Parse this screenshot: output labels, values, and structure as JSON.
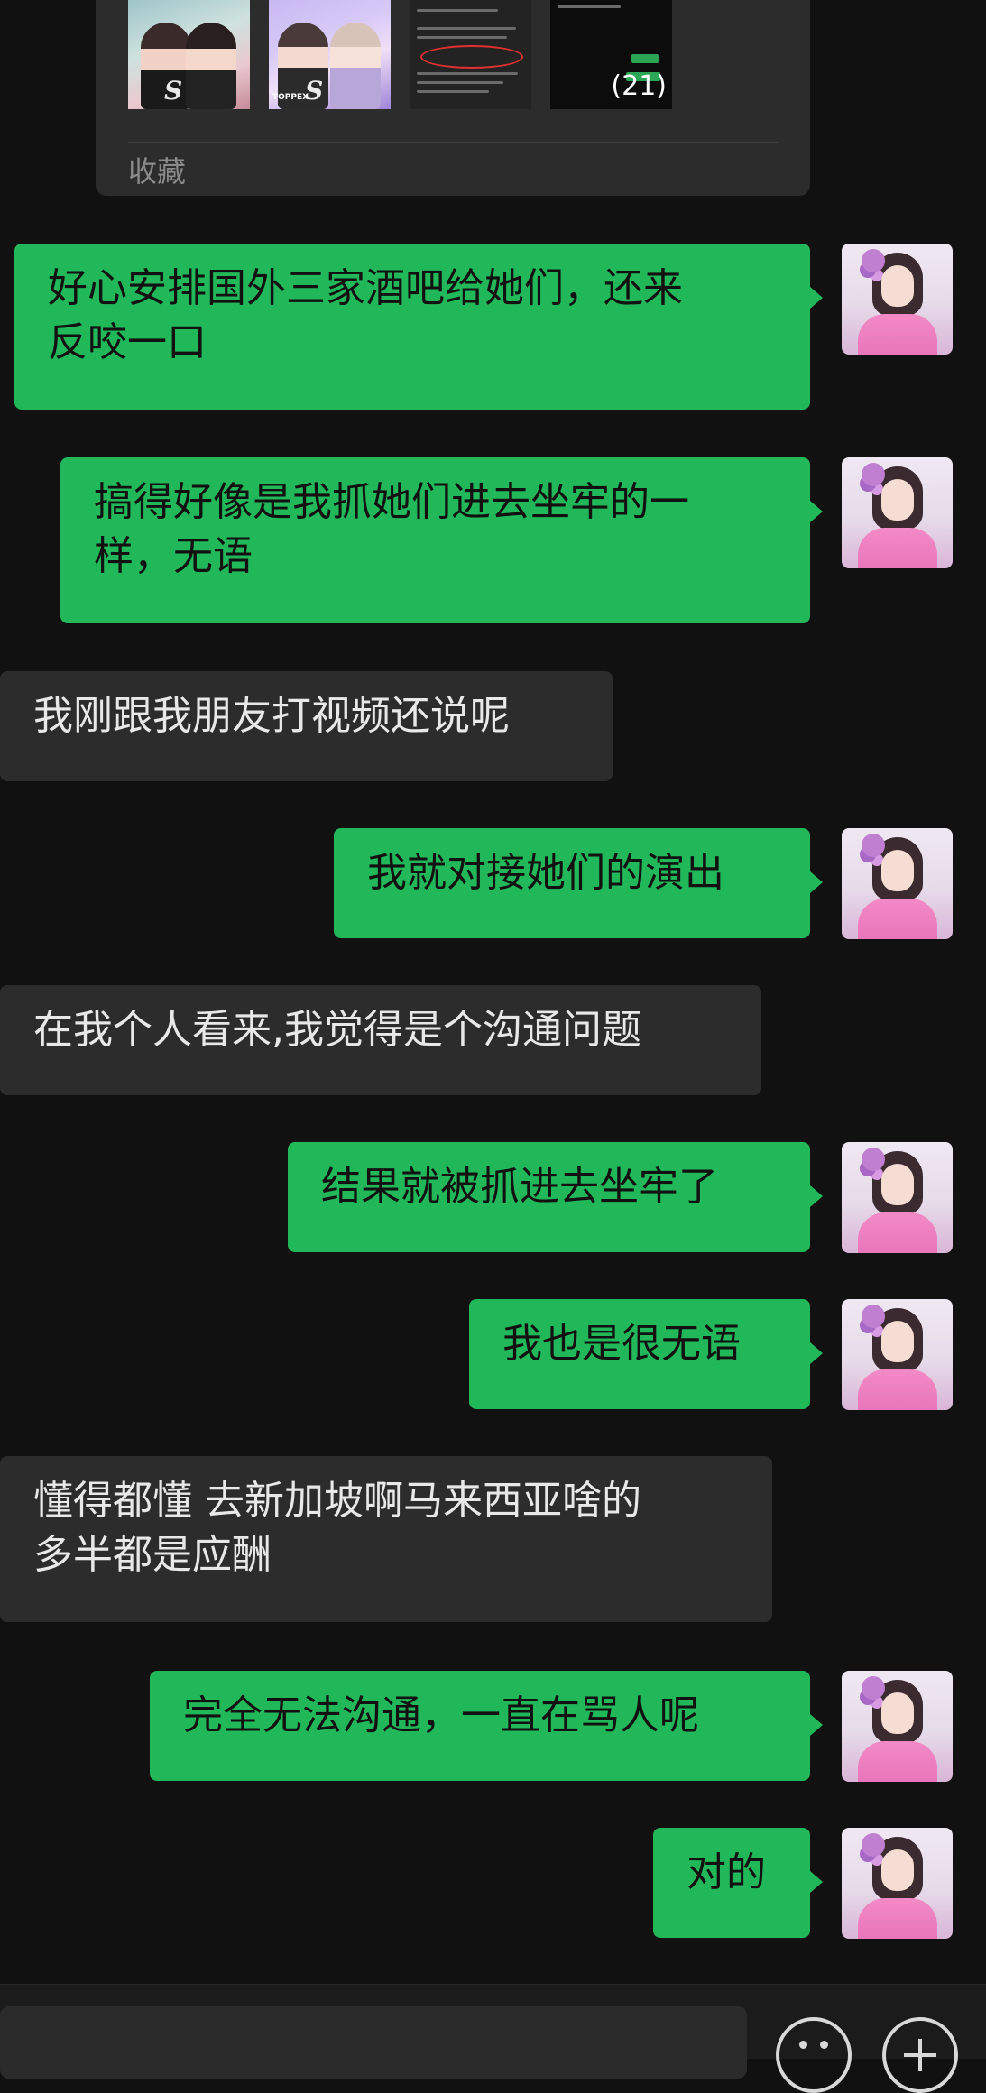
{
  "favorites_card": {
    "label": "收藏",
    "thumbnails": [
      {
        "kind": "poster",
        "caption": "S"
      },
      {
        "kind": "poster",
        "caption": "S",
        "brand": "TOPPEX"
      },
      {
        "kind": "chat-screenshot"
      },
      {
        "kind": "chat-screenshot",
        "count": "(21)"
      }
    ]
  },
  "messages": [
    {
      "side": "out",
      "text": "好心安排国外三家酒吧给她们，还来反咬一口",
      "lines": [
        "好心安排国外三家酒吧给她们，还来",
        "反咬一口"
      ]
    },
    {
      "side": "out",
      "text": "搞得好像是我抓她们进去坐牢的一样，无语",
      "lines": [
        "搞得好像是我抓她们进去坐牢的一",
        "样，无语"
      ]
    },
    {
      "side": "in",
      "text": "我刚跟我朋友打视频还说呢"
    },
    {
      "side": "out",
      "text": "我就对接她们的演出"
    },
    {
      "side": "in",
      "text": "在我个人看来,我觉得是个沟通问题"
    },
    {
      "side": "out",
      "text": "结果就被抓进去坐牢了"
    },
    {
      "side": "out",
      "text": "我也是很无语"
    },
    {
      "side": "in",
      "text": "懂得都懂 去新加坡啊马来西亚啥的多半都是应酬",
      "lines": [
        "懂得都懂 去新加坡啊马来西亚啥的",
        "多半都是应酬"
      ]
    },
    {
      "side": "out",
      "text": "完全无法沟通，一直在骂人呢"
    },
    {
      "side": "out",
      "text": "对的"
    }
  ],
  "colors": {
    "background": "#111111",
    "outgoing_bubble": "#21b85a",
    "incoming_bubble": "#2c2c2c"
  },
  "icons": {
    "emoji": "smiley-face-icon",
    "more": "plus-circle-icon"
  }
}
